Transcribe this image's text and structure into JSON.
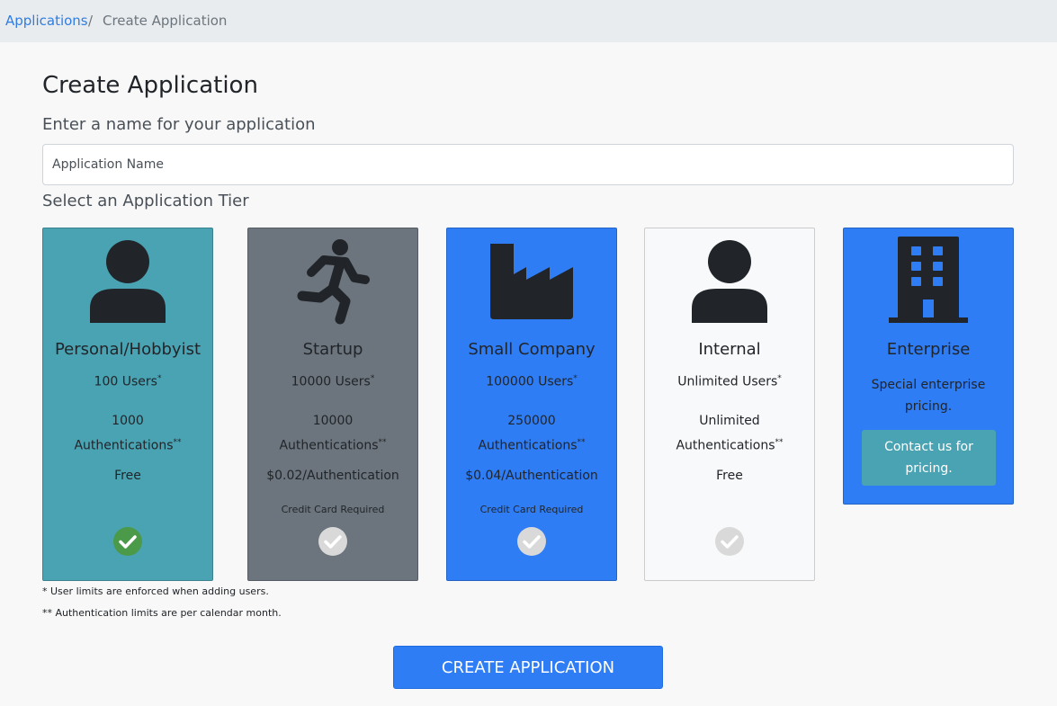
{
  "breadcrumb": {
    "link": "Applications",
    "separator": "/",
    "current": "Create Application"
  },
  "title": "Create Application",
  "name_prompt": "Enter a name for your application",
  "name_input": {
    "placeholder": "Application Name",
    "value": ""
  },
  "tier_prompt": "Select an Application Tier",
  "tiers": [
    {
      "name": "Personal/Hobbyist",
      "users": "100 Users",
      "auth_count": "1000",
      "auth_label": "Authentications",
      "price": "Free",
      "cc": "",
      "icon": "person-icon",
      "bg": "#4aa3b3",
      "selected": true
    },
    {
      "name": "Startup",
      "users": "10000 Users",
      "auth_count": "10000",
      "auth_label": "Authentications",
      "price": "$0.02/Authentication",
      "cc": "Credit Card Required",
      "icon": "running-person-icon",
      "bg": "#6c757d",
      "selected": false
    },
    {
      "name": "Small Company",
      "users": "100000 Users",
      "auth_count": "250000",
      "auth_label": "Authentications",
      "price": "$0.04/Authentication",
      "cc": "Credit Card Required",
      "icon": "factory-icon",
      "bg": "#2f7df5",
      "selected": false
    },
    {
      "name": "Internal",
      "users": "Unlimited Users",
      "auth_count": "Unlimited",
      "auth_label": "Authentications",
      "price": "Free",
      "cc": "",
      "icon": "person-icon",
      "bg": "#f8f9fa",
      "selected": false
    },
    {
      "name": "Enterprise",
      "description": "Special enterprise pricing.",
      "contact": "Contact us for pricing.",
      "icon": "building-icon",
      "bg": "#2f7df5"
    }
  ],
  "footnotes": [
    "* User limits are enforced when adding users.",
    "** Authentication limits are per calendar month."
  ],
  "marks": {
    "users": "*",
    "auth": "**"
  },
  "create_button": "CREATE APPLICATION",
  "colors": {
    "check_selected": "#4a9a4a",
    "check_unselected": "#d9d9d9",
    "icon_dark": "#212529",
    "link": "#2f7de1"
  }
}
